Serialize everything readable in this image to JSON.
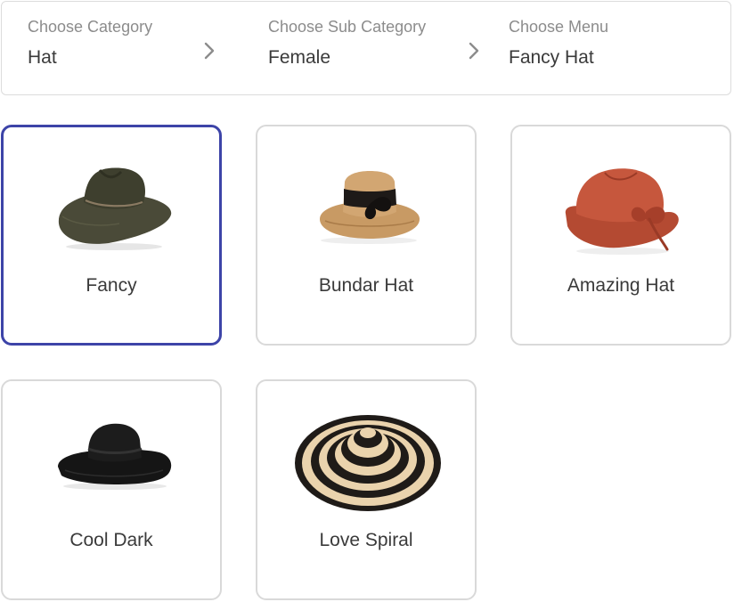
{
  "breadcrumb": {
    "category": {
      "label": "Choose Category",
      "value": "Hat"
    },
    "sub_category": {
      "label": "Choose Sub Category",
      "value": "Female"
    },
    "menu": {
      "label": "Choose Menu",
      "value": "Fancy Hat"
    }
  },
  "items": [
    {
      "name": "Fancy",
      "selected": true,
      "icon": "fedora-hat-icon"
    },
    {
      "name": "Bundar Hat",
      "selected": false,
      "icon": "straw-hat-icon"
    },
    {
      "name": "Amazing Hat",
      "selected": false,
      "icon": "cloche-hat-icon"
    },
    {
      "name": "Cool Dark",
      "selected": false,
      "icon": "floppy-hat-icon"
    },
    {
      "name": "Love Spiral",
      "selected": false,
      "icon": "striped-sun-hat-icon"
    }
  ],
  "colors": {
    "selected_border": "#3d44a8",
    "card_border": "#d9d9d9"
  }
}
